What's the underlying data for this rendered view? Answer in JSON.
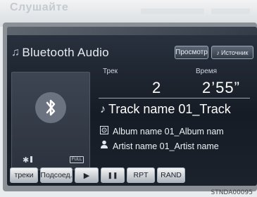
{
  "header_ghost": {
    "title": "Слушайте"
  },
  "app": {
    "title": "Bluetooth Audio"
  },
  "top_buttons": {
    "view": "Просмотр",
    "source": "Источник"
  },
  "track": {
    "label": "Трек",
    "number": "2"
  },
  "time": {
    "label": "Время",
    "value": "2’55”"
  },
  "now_playing": {
    "track_name": "Track name 01_Track",
    "album_name": "Album name 01_Album nam",
    "artist_name": "Artist name 01_Artist name"
  },
  "device": {
    "battery_label": "FULL"
  },
  "bottom_buttons": {
    "tracks": "треки",
    "connect": "Подсоед.",
    "play": "▶",
    "pause": "❚❚",
    "repeat": "RPT",
    "random": "RAND"
  },
  "image_code": "STNDA00095",
  "icons": [
    "music-note-icon",
    "bluetooth-icon",
    "signal-icon",
    "battery-icon",
    "album-icon",
    "artist-icon",
    "source-icon"
  ]
}
